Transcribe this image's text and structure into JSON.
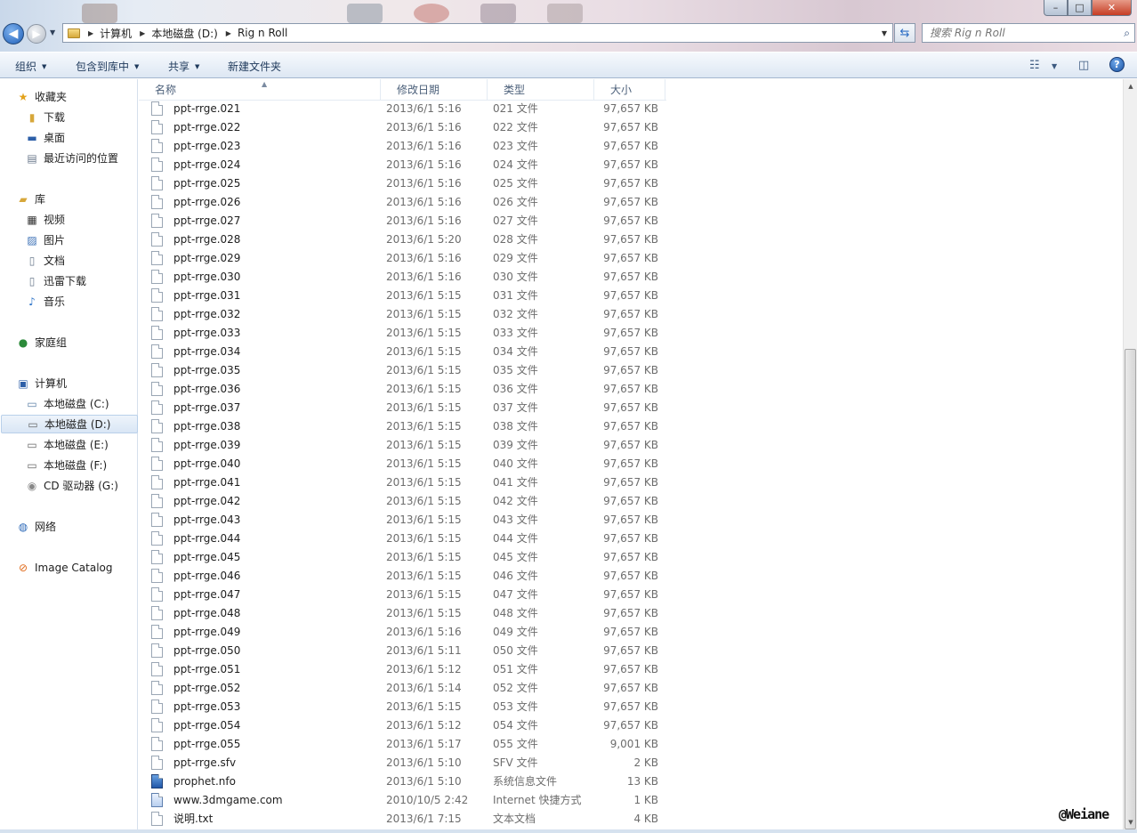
{
  "window": {
    "controls": {
      "min": "–",
      "max": "□",
      "close": "✕"
    }
  },
  "address": {
    "crumbs": [
      "计算机",
      "本地磁盘 (D:)",
      "Rig n Roll"
    ],
    "search_placeholder": "搜索 Rig n Roll"
  },
  "toolbar": {
    "organize": "组织",
    "include_library": "包含到库中",
    "share": "共享",
    "new_folder": "新建文件夹"
  },
  "nav": {
    "favorites": "收藏夹",
    "downloads": "下载",
    "desktop": "桌面",
    "recent": "最近访问的位置",
    "libraries": "库",
    "videos": "视频",
    "pictures": "图片",
    "documents": "文档",
    "xunlei": "迅雷下载",
    "music": "音乐",
    "homegroup": "家庭组",
    "computer": "计算机",
    "drive_c": "本地磁盘 (C:)",
    "drive_d": "本地磁盘 (D:)",
    "drive_e": "本地磁盘 (E:)",
    "drive_f": "本地磁盘 (F:)",
    "drive_g": "CD 驱动器 (G:)",
    "network": "网络",
    "image_catalog": "Image Catalog"
  },
  "columns": {
    "name": "名称",
    "date": "修改日期",
    "type": "类型",
    "size": "大小"
  },
  "files": [
    {
      "name": "ppt-rrge.021",
      "date": "2013/6/1 5:16",
      "type": "021 文件",
      "size": "97,657 KB",
      "icon": "file"
    },
    {
      "name": "ppt-rrge.022",
      "date": "2013/6/1 5:16",
      "type": "022 文件",
      "size": "97,657 KB",
      "icon": "file"
    },
    {
      "name": "ppt-rrge.023",
      "date": "2013/6/1 5:16",
      "type": "023 文件",
      "size": "97,657 KB",
      "icon": "file"
    },
    {
      "name": "ppt-rrge.024",
      "date": "2013/6/1 5:16",
      "type": "024 文件",
      "size": "97,657 KB",
      "icon": "file"
    },
    {
      "name": "ppt-rrge.025",
      "date": "2013/6/1 5:16",
      "type": "025 文件",
      "size": "97,657 KB",
      "icon": "file"
    },
    {
      "name": "ppt-rrge.026",
      "date": "2013/6/1 5:16",
      "type": "026 文件",
      "size": "97,657 KB",
      "icon": "file"
    },
    {
      "name": "ppt-rrge.027",
      "date": "2013/6/1 5:16",
      "type": "027 文件",
      "size": "97,657 KB",
      "icon": "file"
    },
    {
      "name": "ppt-rrge.028",
      "date": "2013/6/1 5:20",
      "type": "028 文件",
      "size": "97,657 KB",
      "icon": "file"
    },
    {
      "name": "ppt-rrge.029",
      "date": "2013/6/1 5:16",
      "type": "029 文件",
      "size": "97,657 KB",
      "icon": "file"
    },
    {
      "name": "ppt-rrge.030",
      "date": "2013/6/1 5:16",
      "type": "030 文件",
      "size": "97,657 KB",
      "icon": "file"
    },
    {
      "name": "ppt-rrge.031",
      "date": "2013/6/1 5:15",
      "type": "031 文件",
      "size": "97,657 KB",
      "icon": "file"
    },
    {
      "name": "ppt-rrge.032",
      "date": "2013/6/1 5:15",
      "type": "032 文件",
      "size": "97,657 KB",
      "icon": "file"
    },
    {
      "name": "ppt-rrge.033",
      "date": "2013/6/1 5:15",
      "type": "033 文件",
      "size": "97,657 KB",
      "icon": "file"
    },
    {
      "name": "ppt-rrge.034",
      "date": "2013/6/1 5:15",
      "type": "034 文件",
      "size": "97,657 KB",
      "icon": "file"
    },
    {
      "name": "ppt-rrge.035",
      "date": "2013/6/1 5:15",
      "type": "035 文件",
      "size": "97,657 KB",
      "icon": "file"
    },
    {
      "name": "ppt-rrge.036",
      "date": "2013/6/1 5:15",
      "type": "036 文件",
      "size": "97,657 KB",
      "icon": "file"
    },
    {
      "name": "ppt-rrge.037",
      "date": "2013/6/1 5:15",
      "type": "037 文件",
      "size": "97,657 KB",
      "icon": "file"
    },
    {
      "name": "ppt-rrge.038",
      "date": "2013/6/1 5:15",
      "type": "038 文件",
      "size": "97,657 KB",
      "icon": "file"
    },
    {
      "name": "ppt-rrge.039",
      "date": "2013/6/1 5:15",
      "type": "039 文件",
      "size": "97,657 KB",
      "icon": "file"
    },
    {
      "name": "ppt-rrge.040",
      "date": "2013/6/1 5:15",
      "type": "040 文件",
      "size": "97,657 KB",
      "icon": "file"
    },
    {
      "name": "ppt-rrge.041",
      "date": "2013/6/1 5:15",
      "type": "041 文件",
      "size": "97,657 KB",
      "icon": "file"
    },
    {
      "name": "ppt-rrge.042",
      "date": "2013/6/1 5:15",
      "type": "042 文件",
      "size": "97,657 KB",
      "icon": "file"
    },
    {
      "name": "ppt-rrge.043",
      "date": "2013/6/1 5:15",
      "type": "043 文件",
      "size": "97,657 KB",
      "icon": "file"
    },
    {
      "name": "ppt-rrge.044",
      "date": "2013/6/1 5:15",
      "type": "044 文件",
      "size": "97,657 KB",
      "icon": "file"
    },
    {
      "name": "ppt-rrge.045",
      "date": "2013/6/1 5:15",
      "type": "045 文件",
      "size": "97,657 KB",
      "icon": "file"
    },
    {
      "name": "ppt-rrge.046",
      "date": "2013/6/1 5:15",
      "type": "046 文件",
      "size": "97,657 KB",
      "icon": "file"
    },
    {
      "name": "ppt-rrge.047",
      "date": "2013/6/1 5:15",
      "type": "047 文件",
      "size": "97,657 KB",
      "icon": "file"
    },
    {
      "name": "ppt-rrge.048",
      "date": "2013/6/1 5:15",
      "type": "048 文件",
      "size": "97,657 KB",
      "icon": "file"
    },
    {
      "name": "ppt-rrge.049",
      "date": "2013/6/1 5:16",
      "type": "049 文件",
      "size": "97,657 KB",
      "icon": "file"
    },
    {
      "name": "ppt-rrge.050",
      "date": "2013/6/1 5:11",
      "type": "050 文件",
      "size": "97,657 KB",
      "icon": "file"
    },
    {
      "name": "ppt-rrge.051",
      "date": "2013/6/1 5:12",
      "type": "051 文件",
      "size": "97,657 KB",
      "icon": "file"
    },
    {
      "name": "ppt-rrge.052",
      "date": "2013/6/1 5:14",
      "type": "052 文件",
      "size": "97,657 KB",
      "icon": "file"
    },
    {
      "name": "ppt-rrge.053",
      "date": "2013/6/1 5:15",
      "type": "053 文件",
      "size": "97,657 KB",
      "icon": "file"
    },
    {
      "name": "ppt-rrge.054",
      "date": "2013/6/1 5:12",
      "type": "054 文件",
      "size": "97,657 KB",
      "icon": "file"
    },
    {
      "name": "ppt-rrge.055",
      "date": "2013/6/1 5:17",
      "type": "055 文件",
      "size": "9,001 KB",
      "icon": "file"
    },
    {
      "name": "ppt-rrge.sfv",
      "date": "2013/6/1 5:10",
      "type": "SFV 文件",
      "size": "2 KB",
      "icon": "file"
    },
    {
      "name": "prophet.nfo",
      "date": "2013/6/1 5:10",
      "type": "系统信息文件",
      "size": "13 KB",
      "icon": "nfo"
    },
    {
      "name": "www.3dmgame.com",
      "date": "2010/10/5 2:42",
      "type": "Internet 快捷方式",
      "size": "1 KB",
      "icon": "link"
    },
    {
      "name": "说明.txt",
      "date": "2013/6/1 7:15",
      "type": "文本文档",
      "size": "4 KB",
      "icon": "file"
    }
  ],
  "watermark": "@Weiane"
}
